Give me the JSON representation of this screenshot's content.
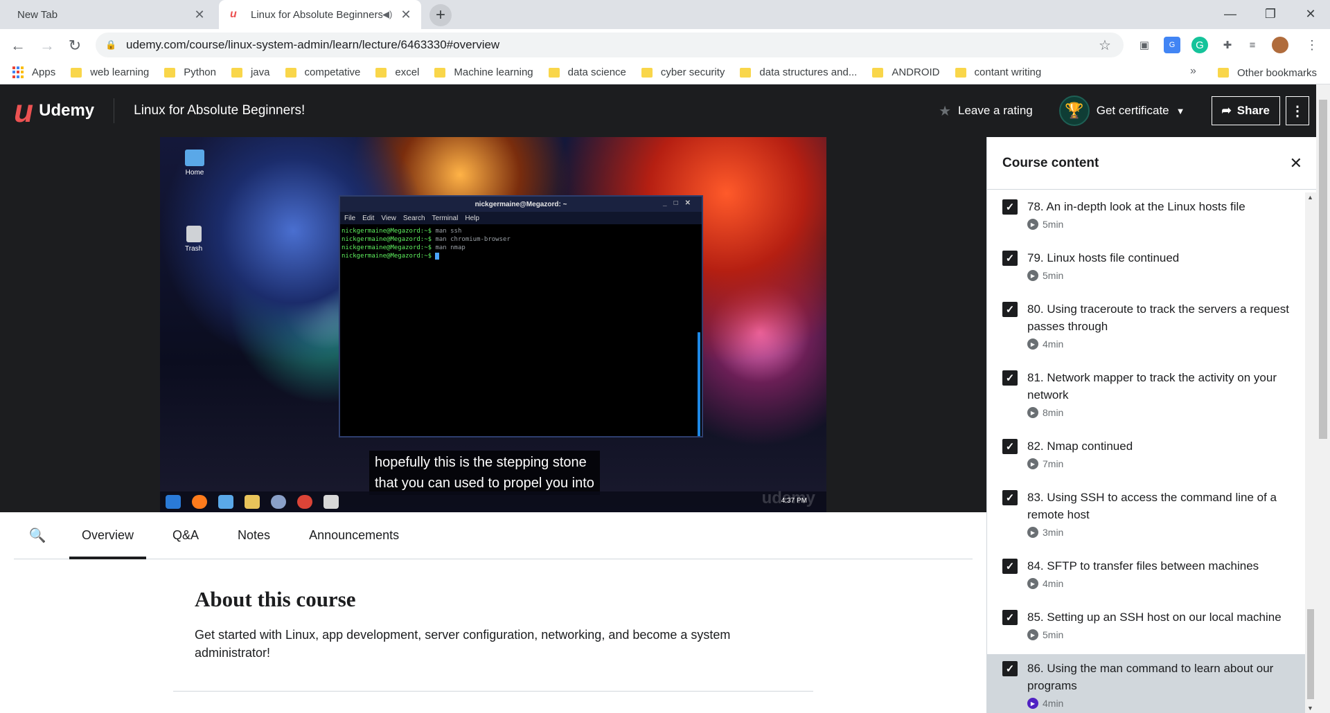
{
  "browser": {
    "tabs": [
      {
        "title": "New Tab",
        "active": false
      },
      {
        "title": "Linux for Absolute Beginners",
        "active": true
      }
    ],
    "new_tab_label": "+",
    "url": "udemy.com/course/linux-system-admin/learn/lecture/6463330#overview",
    "bookmarks": [
      "Apps",
      "web learning",
      "Python",
      "java",
      "competative",
      "excel",
      "Machine learning",
      "data science",
      "cyber security",
      "data structures and...",
      "ANDROID",
      "contant writing"
    ],
    "bookmarks_more": "»",
    "other_bookmarks": "Other bookmarks"
  },
  "header": {
    "logo_text": "Udemy",
    "course_title": "Linux for Absolute Beginners!",
    "leave_rating": "Leave a rating",
    "get_certificate": "Get certificate",
    "share": "Share"
  },
  "video": {
    "desktop_icons": [
      "Home",
      "Trash"
    ],
    "terminal_title": "nickgermaine@Megazord: ~",
    "terminal_menu": [
      "File",
      "Edit",
      "View",
      "Search",
      "Terminal",
      "Help"
    ],
    "terminal_lines": [
      {
        "prompt": "nickgermaine@Megazord:~$",
        "cmd": "man ssh"
      },
      {
        "prompt": "nickgermaine@Megazord:~$",
        "cmd": "man chromium-browser"
      },
      {
        "prompt": "nickgermaine@Megazord:~$",
        "cmd": "man nmap"
      },
      {
        "prompt": "nickgermaine@Megazord:~$",
        "cmd": ""
      }
    ],
    "subtitle_line1": "hopefully this is the stepping stone",
    "subtitle_line2": "that you can used to propel you into",
    "clock": "4:37 PM",
    "watermark": "udemy"
  },
  "content_tabs": [
    "Overview",
    "Q&A",
    "Notes",
    "Announcements"
  ],
  "about": {
    "heading": "About this course",
    "description": "Get started with Linux, app development, server configuration, networking, and become a system administrator!"
  },
  "sidebar": {
    "title": "Course content",
    "lectures": [
      {
        "title": "78. An in-depth look at the Linux hosts file",
        "duration": "5min",
        "current": false
      },
      {
        "title": "79. Linux hosts file continued",
        "duration": "5min",
        "current": false
      },
      {
        "title": "80. Using traceroute to track the servers a request passes through",
        "duration": "4min",
        "current": false
      },
      {
        "title": "81. Network mapper to track the activity on your network",
        "duration": "8min",
        "current": false
      },
      {
        "title": "82. Nmap continued",
        "duration": "7min",
        "current": false
      },
      {
        "title": "83. Using SSH to access the command line of a remote host",
        "duration": "3min",
        "current": false
      },
      {
        "title": "84. SFTP to transfer files between machines",
        "duration": "4min",
        "current": false
      },
      {
        "title": "85. Setting up an SSH host on our local machine",
        "duration": "5min",
        "current": false
      },
      {
        "title": "86. Using the man command to learn about our programs",
        "duration": "4min",
        "current": true
      }
    ]
  },
  "colors": {
    "udemy_brand": "#ec5252",
    "header_bg": "#1c1d1f",
    "current_lecture_bg": "#d1d7dc"
  }
}
